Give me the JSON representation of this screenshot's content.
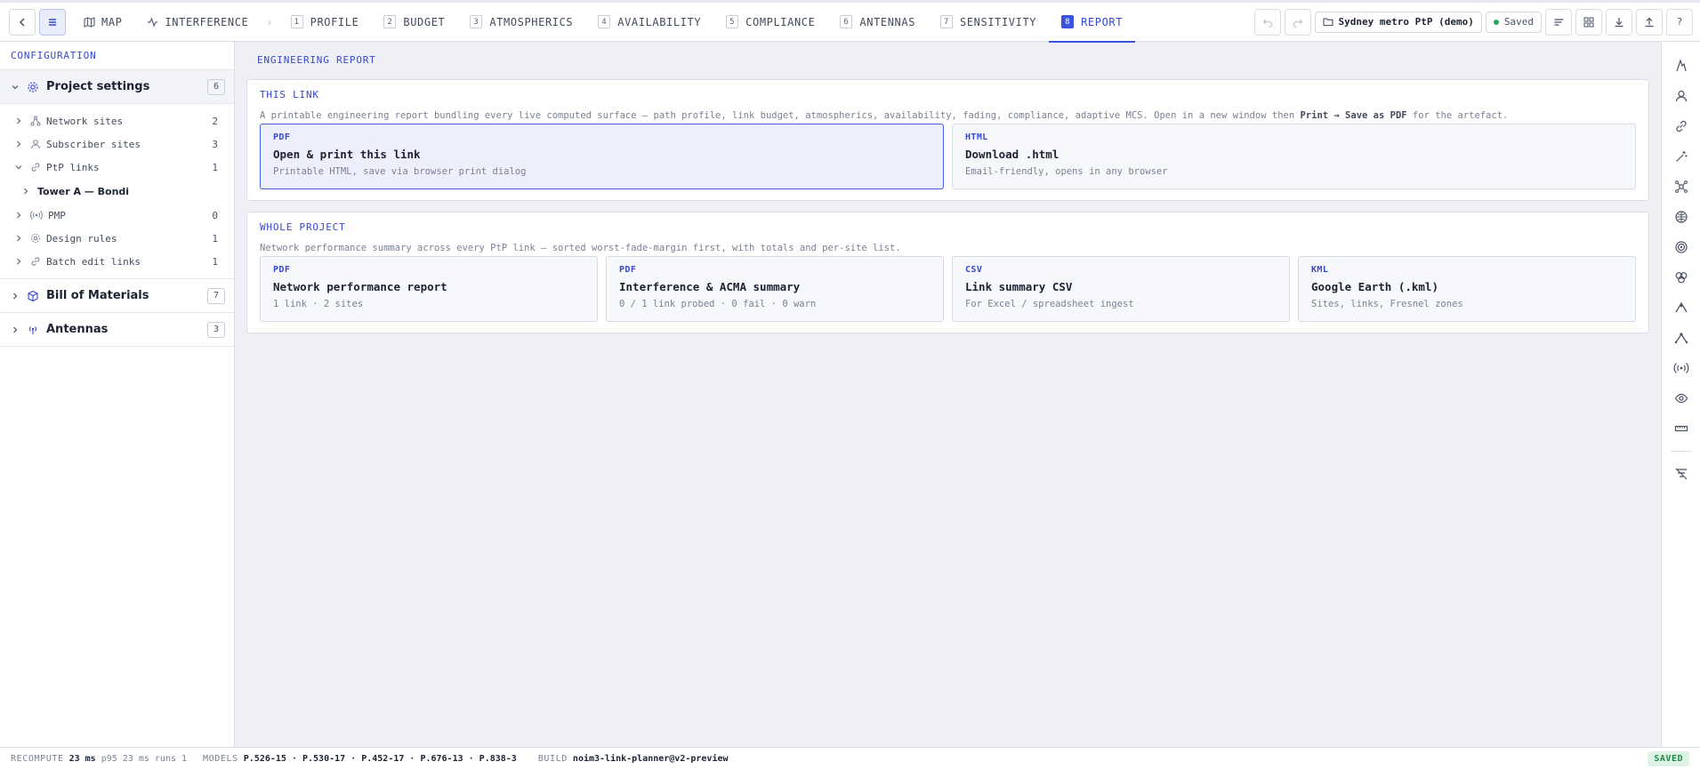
{
  "nav": {
    "tabs": [
      {
        "label": "MAP",
        "num": ""
      },
      {
        "label": "INTERFERENCE",
        "num": ""
      },
      {
        "label": "PROFILE",
        "num": "1"
      },
      {
        "label": "BUDGET",
        "num": "2"
      },
      {
        "label": "ATMOSPHERICS",
        "num": "3"
      },
      {
        "label": "AVAILABILITY",
        "num": "4"
      },
      {
        "label": "COMPLIANCE",
        "num": "5"
      },
      {
        "label": "ANTENNAS",
        "num": "6"
      },
      {
        "label": "SENSITIVITY",
        "num": "7"
      },
      {
        "label": "REPORT",
        "num": "8"
      }
    ],
    "project_name": "Sydney metro PtP (demo)",
    "saved_label": "Saved",
    "help_label": "?"
  },
  "sidebar": {
    "title": "CONFIGURATION",
    "project_settings": {
      "label": "Project settings",
      "count": "6"
    },
    "items": [
      {
        "label": "Network sites",
        "count": "2"
      },
      {
        "label": "Subscriber sites",
        "count": "3"
      },
      {
        "label": "PtP links",
        "count": "1"
      },
      {
        "label": "PMP",
        "count": "0"
      },
      {
        "label": "Design rules",
        "count": "1"
      },
      {
        "label": "Batch edit links",
        "count": "1"
      }
    ],
    "link_child": "Tower A — Bondi",
    "bom": {
      "label": "Bill of Materials",
      "count": "7"
    },
    "antennas": {
      "label": "Antennas",
      "count": "3"
    }
  },
  "main": {
    "title": "ENGINEERING REPORT",
    "this_link": {
      "title": "THIS LINK",
      "desc_pre": "A printable engineering report bundling every live computed surface — path profile, link budget, atmospherics, availability, fading, compliance, adaptive MCS. Open in a new window then ",
      "desc_bold": "Print → Save as PDF",
      "desc_post": " for the artefact.",
      "cards": [
        {
          "fmt": "PDF",
          "title": "Open & print this link",
          "meta": "Printable HTML, save via browser print dialog"
        },
        {
          "fmt": "HTML",
          "title": "Download .html",
          "meta": "Email-friendly, opens in any browser"
        }
      ]
    },
    "whole_project": {
      "title": "WHOLE PROJECT",
      "desc": "Network performance summary across every PtP link — sorted worst-fade-margin first, with totals and per-site list.",
      "cards": [
        {
          "fmt": "PDF",
          "title": "Network performance report",
          "meta": "1 link · 2 sites"
        },
        {
          "fmt": "PDF",
          "title": "Interference & ACMA summary",
          "meta": "0 / 1 link probed · 0 fail · 0 warn"
        },
        {
          "fmt": "CSV",
          "title": "Link summary CSV",
          "meta": "For Excel / spreadsheet ingest"
        },
        {
          "fmt": "KML",
          "title": "Google Earth (.kml)",
          "meta": "Sites, links, Fresnel zones"
        }
      ]
    }
  },
  "status": {
    "recompute_label": "RECOMPUTE",
    "recompute_value": "23 ms",
    "recompute_extra": "p95 23 ms runs 1",
    "models_label": "MODELS",
    "models_value": "P.526-15 · P.530-17 · P.452-17 · P.676-13 · P.838-3",
    "build_label": "BUILD",
    "build_value": "noim3-link-planner@v2-preview",
    "saved_tag": "SAVED"
  },
  "colors": {
    "accent": "#3c53e0",
    "saved_green": "#22a55b"
  }
}
